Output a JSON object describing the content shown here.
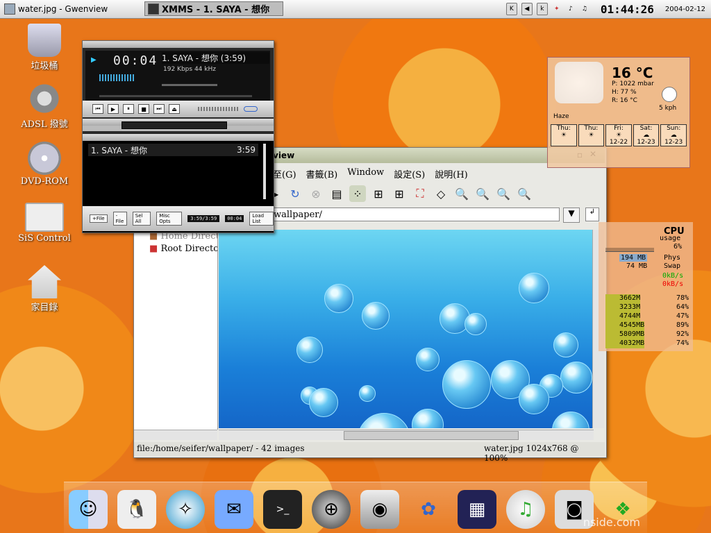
{
  "panel": {
    "tasks": [
      {
        "label": "water.jpg - Gwenview",
        "active": false
      },
      {
        "label": "XMMS - 1. SAYA - 想你",
        "active": true
      }
    ],
    "clock": "01:44:26",
    "date": "2004-02-12"
  },
  "desktop": {
    "icons": [
      {
        "label": "垃圾桶",
        "icon": "trash-icon"
      },
      {
        "label": "ADSL 撥號",
        "icon": "network-icon"
      },
      {
        "label": "DVD-ROM",
        "icon": "dvd-icon"
      },
      {
        "label": "SiS Control",
        "icon": "monitor-icon"
      },
      {
        "label": "家目錄",
        "icon": "home-icon"
      }
    ]
  },
  "xmms": {
    "time": "00:04",
    "title": "1. SAYA - 想你 (3:59)",
    "kbps": "192 Kbps",
    "khz": "44 kHz",
    "playlist": {
      "track": "1. SAYA - 想你",
      "duration": "3:59"
    },
    "buttons": [
      "+File",
      "-File",
      "Sel All",
      "Misc Opts"
    ],
    "load_list": "Load List",
    "pos": "3:59/3:59",
    "elapsed": "00:04"
  },
  "gwenview": {
    "title": "view",
    "menu": [
      "至(G)",
      "書籤(B)",
      "Window",
      "設定(S)",
      "說明(H)"
    ],
    "url": "wallpaper/",
    "tree": [
      "Home Directo",
      "Root Director"
    ],
    "status_left": "file:/home/seifer/wallpaper/ - 42 images",
    "status_right": "water.jpg 1024x768 @ 100%"
  },
  "weather": {
    "temp": "16 °C",
    "pressure": "P: 1022 mbar",
    "humidity": "H: 77 %",
    "real": "R: 16 °C",
    "wind": "5 kph",
    "condition": "Haze",
    "days": [
      "Thu:",
      "Thu:",
      "Fri:",
      "Sat:",
      "Sun:"
    ],
    "dates": [
      "12-22",
      "12-23",
      "12-23"
    ]
  },
  "cpu": {
    "title": "CPU",
    "usage_label": "usage",
    "usage": "6%",
    "phys_val": "194 MB",
    "phys": "Phys",
    "swap_val": "74 MB",
    "swap": "Swap",
    "net1": "0kB/s",
    "net2": "0kB/s",
    "disks": [
      {
        "size": "3662M",
        "pct": "78%"
      },
      {
        "size": "3233M",
        "pct": "64%"
      },
      {
        "size": "4744M",
        "pct": "47%"
      },
      {
        "size": "4545MB",
        "pct": "89%"
      },
      {
        "size": "5809MB",
        "pct": "92%"
      },
      {
        "size": "4032MB",
        "pct": "74%"
      }
    ]
  },
  "dock": {
    "items": [
      "finder-icon",
      "tux-icon",
      "safari-icon",
      "mail-icon",
      "terminal-icon",
      "globe-icon",
      "harddisk-icon",
      "msn-icon",
      "clapper-icon",
      "itunes-icon",
      "camera-icon",
      "windows-icon"
    ],
    "watermark": "nside.com"
  }
}
